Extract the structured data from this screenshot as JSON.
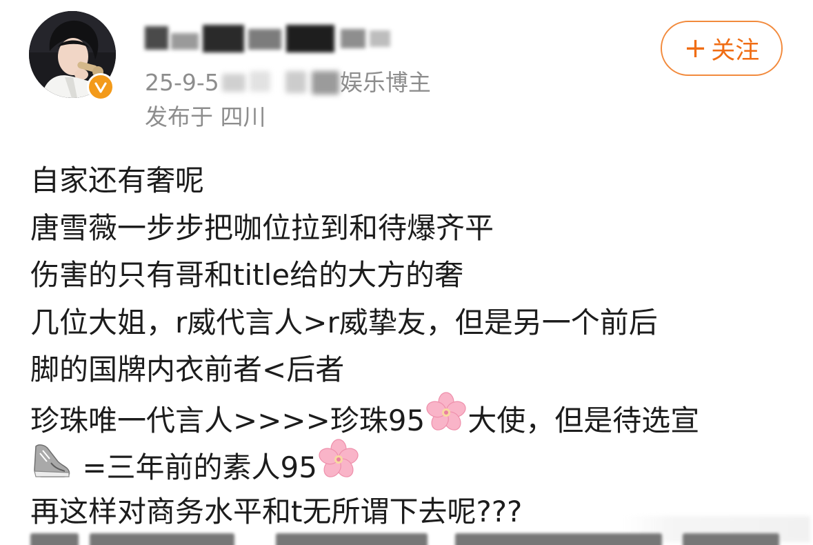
{
  "author": {
    "location_label": "发布于 四川",
    "date_prefix": "25-9-5",
    "role_suffix": "娱乐博主",
    "verified_color": "#f39a1a"
  },
  "follow_button": {
    "icon": "plus-icon",
    "plus": "+",
    "label": "关注",
    "color": "#f06d14"
  },
  "post": {
    "lines": [
      "自家还有奢呢",
      "唐雪薇一步步把咖位拉到和待爆齐平",
      "伤害的只有哥和title给的大方的奢",
      "几位大姐，r威代言人>r威挚友，但是另一个前后",
      "脚的国牌内衣前者<后者"
    ],
    "line6_text_a": "珍珠唯一代言人>>>>珍珠95",
    "line6_text_b": "大使，但是待选宣",
    "line7_text": " =三年前的素人95",
    "line8_text": "再这样对商务水平和t无所谓下去呢???",
    "emojis": [
      "cherry-blossom-icon",
      "sneaker-icon"
    ]
  }
}
